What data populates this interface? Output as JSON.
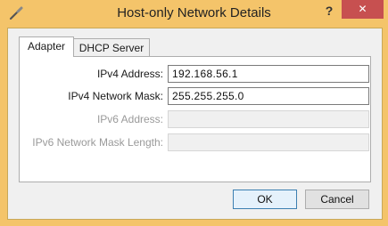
{
  "window": {
    "title": "Host-only Network Details",
    "help_label": "?",
    "close_label": "✕"
  },
  "tabs": [
    {
      "label": "Adapter",
      "selected": true
    },
    {
      "label": "DHCP Server",
      "selected": false
    }
  ],
  "adapter": {
    "ipv4_address_label": "IPv4 Address:",
    "ipv4_address_value": "192.168.56.1",
    "ipv4_mask_label": "IPv4 Network Mask:",
    "ipv4_mask_value": "255.255.255.0",
    "ipv6_address_label": "IPv6 Address:",
    "ipv6_address_value": "",
    "ipv6_mask_label": "IPv6 Network Mask Length:",
    "ipv6_mask_value": ""
  },
  "buttons": {
    "ok_label": "OK",
    "cancel_label": "Cancel"
  },
  "colors": {
    "title_bar": "#f4c46a",
    "close_button": "#c75050"
  }
}
